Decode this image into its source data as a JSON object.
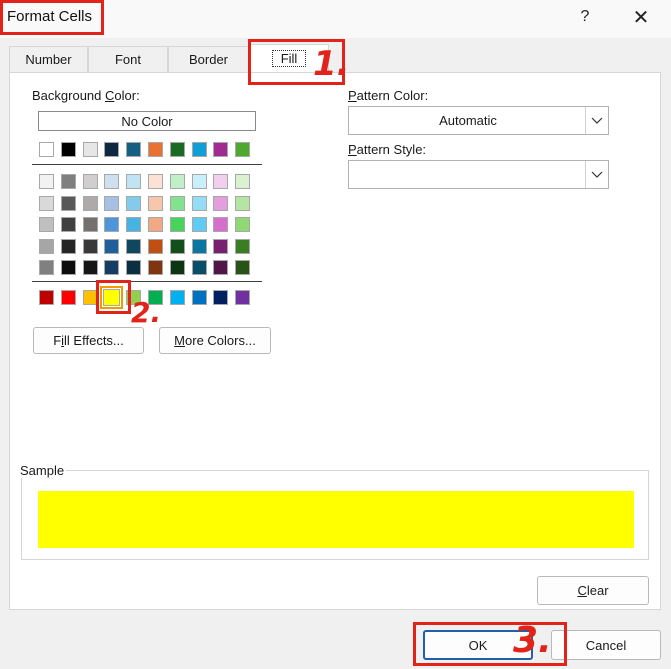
{
  "dialog": {
    "title": "Format Cells",
    "help": "?",
    "close": "✕"
  },
  "tabs": [
    {
      "label": "Number"
    },
    {
      "label": "Font"
    },
    {
      "label": "Border"
    },
    {
      "label": "Fill"
    }
  ],
  "fill": {
    "background_label_pre": "Background ",
    "background_label_ul": "C",
    "background_label_post": "olor:",
    "no_color": "No Color",
    "fill_effects_ul": "i",
    "fill_effects_pre": "F",
    "fill_effects_post": "ll Effects...",
    "more_colors_ul": "M",
    "more_colors_post": "ore Colors...",
    "pattern_color_ul": "P",
    "pattern_color_post": "attern Color:",
    "pattern_color_value": "Automatic",
    "pattern_style_ul": "P",
    "pattern_style_post": "attern Style:",
    "pattern_style_value": "",
    "sample_label": "Sample",
    "sample_color": "#ffff00"
  },
  "palette": {
    "top_row": [
      "#ffffff",
      "#000000",
      "#e7e6e6",
      "#0e2841",
      "#156082",
      "#e97132",
      "#196b24",
      "#0f9ed5",
      "#a02b93",
      "#4ea72e"
    ],
    "tint_rows": [
      [
        "#f2f2f2",
        "#7f7f7f",
        "#d0cece",
        "#d0dff0",
        "#c1e4f5",
        "#fbe2d5",
        "#c1f0c8",
        "#caeefb",
        "#f2ceef",
        "#d9f2d0"
      ],
      [
        "#d9d9d9",
        "#595959",
        "#aeaaaa",
        "#a6c0e5",
        "#83cbeb",
        "#f7c7ac",
        "#83e28e",
        "#95dcf7",
        "#e59edd",
        "#b4e5a2"
      ],
      [
        "#bfbfbf",
        "#404040",
        "#747070",
        "#4e95d9",
        "#48b3e3",
        "#f1a983",
        "#47d45a",
        "#61cbf3",
        "#d86ecc",
        "#8ed973"
      ],
      [
        "#a6a6a6",
        "#262626",
        "#3a3838",
        "#215f9a",
        "#0f4761",
        "#c04f15",
        "#124f1a",
        "#0b76a0",
        "#782170",
        "#3b7d23"
      ],
      [
        "#808080",
        "#0d0d0d",
        "#171616",
        "#153d64",
        "#0a2f40",
        "#7f3510",
        "#0c3511",
        "#074f69",
        "#501549",
        "#275317"
      ]
    ],
    "standard_row": [
      "#c00000",
      "#ff0000",
      "#ffc000",
      "#ffff00",
      "#92d050",
      "#00b050",
      "#00b0f0",
      "#0070c0",
      "#002060",
      "#7030a0"
    ]
  },
  "buttons": {
    "clear_ul": "C",
    "clear_post": "lear",
    "ok": "OK",
    "cancel": "Cancel"
  },
  "annotations": {
    "one": "1.",
    "two": "2.",
    "three": "3.",
    "color": "#e2231a"
  }
}
